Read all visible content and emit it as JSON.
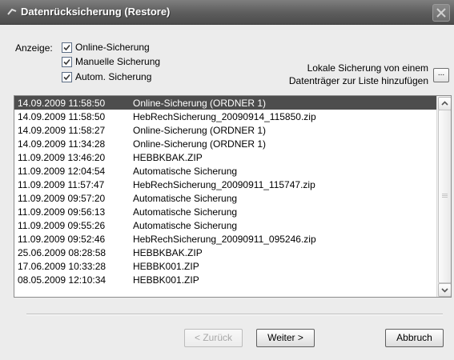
{
  "window": {
    "title": "Datenrücksicherung (Restore)"
  },
  "display": {
    "label": "Anzeige:",
    "options": [
      {
        "label": "Online-Sicherung",
        "checked": true
      },
      {
        "label": "Manuelle Sicherung",
        "checked": true
      },
      {
        "label": "Autom. Sicherung",
        "checked": true
      }
    ]
  },
  "local": {
    "text_line1": "Lokale Sicherung von einem",
    "text_line2": "Datenträger zur Liste hinzufügen",
    "button_label": "..."
  },
  "list": {
    "rows": [
      {
        "date": "14.09.2009 11:58:50",
        "name": "Online-Sicherung (ORDNER 1)",
        "selected": true
      },
      {
        "date": "14.09.2009 11:58:50",
        "name": "HebRechSicherung_20090914_115850.zip"
      },
      {
        "date": "14.09.2009 11:58:27",
        "name": "Online-Sicherung (ORDNER 1)"
      },
      {
        "date": "14.09.2009 11:34:28",
        "name": "Online-Sicherung (ORDNER 1)"
      },
      {
        "date": "11.09.2009 13:46:20",
        "name": "HEBBKBAK.ZIP"
      },
      {
        "date": "11.09.2009 12:04:54",
        "name": "Automatische Sicherung"
      },
      {
        "date": "11.09.2009 11:57:47",
        "name": "HebRechSicherung_20090911_115747.zip"
      },
      {
        "date": "11.09.2009 09:57:20",
        "name": "Automatische Sicherung"
      },
      {
        "date": "11.09.2009 09:56:13",
        "name": "Automatische Sicherung"
      },
      {
        "date": "11.09.2009 09:55:26",
        "name": "Automatische Sicherung"
      },
      {
        "date": "11.09.2009 09:52:46",
        "name": "HebRechSicherung_20090911_095246.zip"
      },
      {
        "date": "25.06.2009 08:28:58",
        "name": "HEBBKBAK.ZIP"
      },
      {
        "date": "17.06.2009 10:33:28",
        "name": "HEBBK001.ZIP"
      },
      {
        "date": "08.05.2009 12:10:34",
        "name": "HEBBK001.ZIP"
      }
    ]
  },
  "buttons": {
    "back": "< Zurück",
    "next": "Weiter >",
    "cancel": "Abbruch"
  }
}
